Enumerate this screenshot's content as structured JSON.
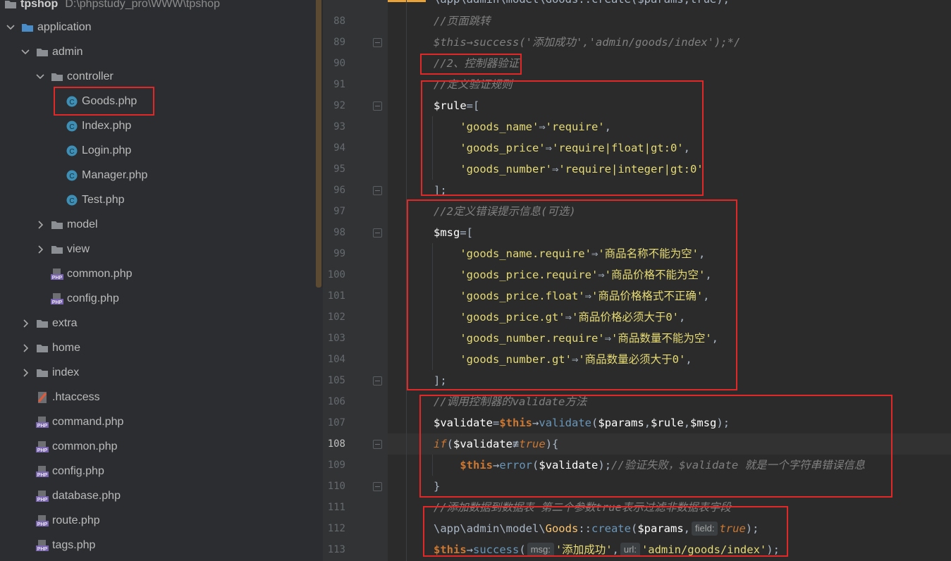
{
  "project": {
    "name": "tpshop",
    "path": "D:\\phpstudy_pro\\WWW\\tpshop"
  },
  "tree": [
    {
      "label": "application",
      "depth": 0,
      "kind": "folder",
      "expanded": true
    },
    {
      "label": "admin",
      "depth": 1,
      "kind": "folder",
      "expanded": true
    },
    {
      "label": "controller",
      "depth": 2,
      "kind": "folder",
      "expanded": true
    },
    {
      "label": "Goods.php",
      "depth": 3,
      "kind": "class-file"
    },
    {
      "label": "Index.php",
      "depth": 3,
      "kind": "class-file"
    },
    {
      "label": "Login.php",
      "depth": 3,
      "kind": "class-file"
    },
    {
      "label": "Manager.php",
      "depth": 3,
      "kind": "class-file"
    },
    {
      "label": "Test.php",
      "depth": 3,
      "kind": "class-file"
    },
    {
      "label": "model",
      "depth": 2,
      "kind": "folder",
      "expanded": false
    },
    {
      "label": "view",
      "depth": 2,
      "kind": "folder",
      "expanded": false
    },
    {
      "label": "common.php",
      "depth": 2,
      "kind": "php-file"
    },
    {
      "label": "config.php",
      "depth": 2,
      "kind": "php-file"
    },
    {
      "label": "extra",
      "depth": 1,
      "kind": "folder",
      "expanded": false
    },
    {
      "label": "home",
      "depth": 1,
      "kind": "folder",
      "expanded": false
    },
    {
      "label": "index",
      "depth": 1,
      "kind": "folder",
      "expanded": false
    },
    {
      "label": ".htaccess",
      "depth": 1,
      "kind": "htaccess-file"
    },
    {
      "label": "command.php",
      "depth": 1,
      "kind": "php-file"
    },
    {
      "label": "common.php",
      "depth": 1,
      "kind": "php-file"
    },
    {
      "label": "config.php",
      "depth": 1,
      "kind": "php-file"
    },
    {
      "label": "database.php",
      "depth": 1,
      "kind": "php-file"
    },
    {
      "label": "route.php",
      "depth": 1,
      "kind": "php-file"
    },
    {
      "label": "tags.php",
      "depth": 1,
      "kind": "php-file"
    }
  ],
  "editor": {
    "current_line": "108",
    "lines": [
      {
        "n": "88",
        "parts": [
          {
            "t": "//页面跳转",
            "c": "cm"
          }
        ]
      },
      {
        "n": "89",
        "parts": [
          {
            "t": "$this→success('添加成功','admin/goods/index');*/",
            "c": "cm"
          }
        ]
      },
      {
        "n": "90",
        "parts": [
          {
            "t": "//2、控制器验证",
            "c": "cm"
          }
        ]
      },
      {
        "n": "91",
        "parts": [
          {
            "t": "//定义验证规则",
            "c": "cm"
          }
        ]
      },
      {
        "n": "92",
        "parts": [
          {
            "t": "$rule",
            "c": "vr"
          },
          {
            "t": "=[",
            "c": "op"
          }
        ]
      },
      {
        "n": "93",
        "parts": [
          {
            "t": "    'goods_name'",
            "c": "st"
          },
          {
            "t": "⇒",
            "c": "op"
          },
          {
            "t": "'require'",
            "c": "st"
          },
          {
            "t": ",",
            "c": "op"
          }
        ]
      },
      {
        "n": "94",
        "parts": [
          {
            "t": "    'goods_price'",
            "c": "st"
          },
          {
            "t": "⇒",
            "c": "op"
          },
          {
            "t": "'require|float|gt:0'",
            "c": "st"
          },
          {
            "t": ",",
            "c": "op"
          }
        ]
      },
      {
        "n": "95",
        "parts": [
          {
            "t": "    'goods_number'",
            "c": "st"
          },
          {
            "t": "⇒",
            "c": "op"
          },
          {
            "t": "'require|integer|gt:0'",
            "c": "st"
          }
        ]
      },
      {
        "n": "96",
        "parts": [
          {
            "t": "];",
            "c": "op"
          }
        ]
      },
      {
        "n": "97",
        "parts": [
          {
            "t": "//2定义错误提示信息(可选)",
            "c": "cm"
          }
        ]
      },
      {
        "n": "98",
        "parts": [
          {
            "t": "$msg",
            "c": "vr"
          },
          {
            "t": "=[",
            "c": "op"
          }
        ]
      },
      {
        "n": "99",
        "parts": [
          {
            "t": "    'goods_name.require'",
            "c": "st"
          },
          {
            "t": "⇒",
            "c": "op"
          },
          {
            "t": "'商品名称不能为空'",
            "c": "st"
          },
          {
            "t": ",",
            "c": "op"
          }
        ]
      },
      {
        "n": "100",
        "parts": [
          {
            "t": "    'goods_price.require'",
            "c": "st"
          },
          {
            "t": "⇒",
            "c": "op"
          },
          {
            "t": "'商品价格不能为空'",
            "c": "st"
          },
          {
            "t": ",",
            "c": "op"
          }
        ]
      },
      {
        "n": "101",
        "parts": [
          {
            "t": "    'goods_price.float'",
            "c": "st"
          },
          {
            "t": "⇒",
            "c": "op"
          },
          {
            "t": "'商品价格格式不正确'",
            "c": "st"
          },
          {
            "t": ",",
            "c": "op"
          }
        ]
      },
      {
        "n": "102",
        "parts": [
          {
            "t": "    'goods_price.gt'",
            "c": "st"
          },
          {
            "t": "⇒",
            "c": "op"
          },
          {
            "t": "'商品价格必须大于0'",
            "c": "st"
          },
          {
            "t": ",",
            "c": "op"
          }
        ]
      },
      {
        "n": "103",
        "parts": [
          {
            "t": "    'goods_number.require'",
            "c": "st"
          },
          {
            "t": "⇒",
            "c": "op"
          },
          {
            "t": "'商品数量不能为空'",
            "c": "st"
          },
          {
            "t": ",",
            "c": "op"
          }
        ]
      },
      {
        "n": "104",
        "parts": [
          {
            "t": "    'goods_number.gt'",
            "c": "st"
          },
          {
            "t": "⇒",
            "c": "op"
          },
          {
            "t": "'商品数量必须大于0'",
            "c": "st"
          },
          {
            "t": ",",
            "c": "op"
          }
        ]
      },
      {
        "n": "105",
        "parts": [
          {
            "t": "];",
            "c": "op"
          }
        ]
      },
      {
        "n": "106",
        "parts": [
          {
            "t": "//调用控制器的validate方法",
            "c": "cm"
          }
        ]
      },
      {
        "n": "107",
        "parts": [
          {
            "t": "$validate",
            "c": "vr"
          },
          {
            "t": "=",
            "c": "op"
          },
          {
            "t": "$this",
            "c": "th"
          },
          {
            "t": "→",
            "c": "op"
          },
          {
            "t": "validate",
            "c": "fn"
          },
          {
            "t": "(",
            "c": "op"
          },
          {
            "t": "$params",
            "c": "vr"
          },
          {
            "t": ",",
            "c": "op"
          },
          {
            "t": "$rule",
            "c": "vr"
          },
          {
            "t": ",",
            "c": "op"
          },
          {
            "t": "$msg",
            "c": "vr"
          },
          {
            "t": ");",
            "c": "op"
          }
        ]
      },
      {
        "n": "108",
        "parts": [
          {
            "t": "if",
            "c": "kw"
          },
          {
            "t": "(",
            "c": "op"
          },
          {
            "t": "$validate",
            "c": "vr"
          },
          {
            "t": "≢",
            "c": "op"
          },
          {
            "t": "true",
            "c": "kw"
          },
          {
            "t": "){",
            "c": "op"
          }
        ]
      },
      {
        "n": "109",
        "parts": [
          {
            "t": "    $this",
            "c": "th"
          },
          {
            "t": "→",
            "c": "op"
          },
          {
            "t": "error",
            "c": "fn"
          },
          {
            "t": "(",
            "c": "op"
          },
          {
            "t": "$validate",
            "c": "vr"
          },
          {
            "t": ");",
            "c": "op"
          },
          {
            "t": "//验证失败，$validate 就是一个字符串错误信息",
            "c": "cm"
          }
        ]
      },
      {
        "n": "110",
        "parts": [
          {
            "t": "}",
            "c": "op"
          }
        ]
      },
      {
        "n": "111",
        "parts": [
          {
            "t": "//添加数据到数据表 第二个参数true表示过滤非数据表字段",
            "c": "cm"
          }
        ]
      },
      {
        "n": "112",
        "parts": [
          {
            "t": "\\app\\admin\\model\\",
            "c": "op"
          },
          {
            "t": "Goods",
            "c": "cl"
          },
          {
            "t": "::",
            "c": "op"
          },
          {
            "t": "create",
            "c": "fn"
          },
          {
            "t": "(",
            "c": "op"
          },
          {
            "t": "$params",
            "c": "vr"
          },
          {
            "t": ",",
            "c": "op"
          },
          {
            "t": "field:",
            "c": "hint"
          },
          {
            "t": "true",
            "c": "kw"
          },
          {
            "t": ");",
            "c": "op"
          }
        ]
      },
      {
        "n": "113",
        "parts": [
          {
            "t": "$this",
            "c": "th"
          },
          {
            "t": "→",
            "c": "op"
          },
          {
            "t": "success",
            "c": "fn"
          },
          {
            "t": "(",
            "c": "op"
          },
          {
            "t": "msg:",
            "c": "hint"
          },
          {
            "t": "'添加成功'",
            "c": "st"
          },
          {
            "t": ",",
            "c": "op"
          },
          {
            "t": "url:",
            "c": "hint"
          },
          {
            "t": "'admin/goods/index'",
            "c": "st"
          },
          {
            "t": ");",
            "c": "op"
          }
        ]
      }
    ]
  }
}
